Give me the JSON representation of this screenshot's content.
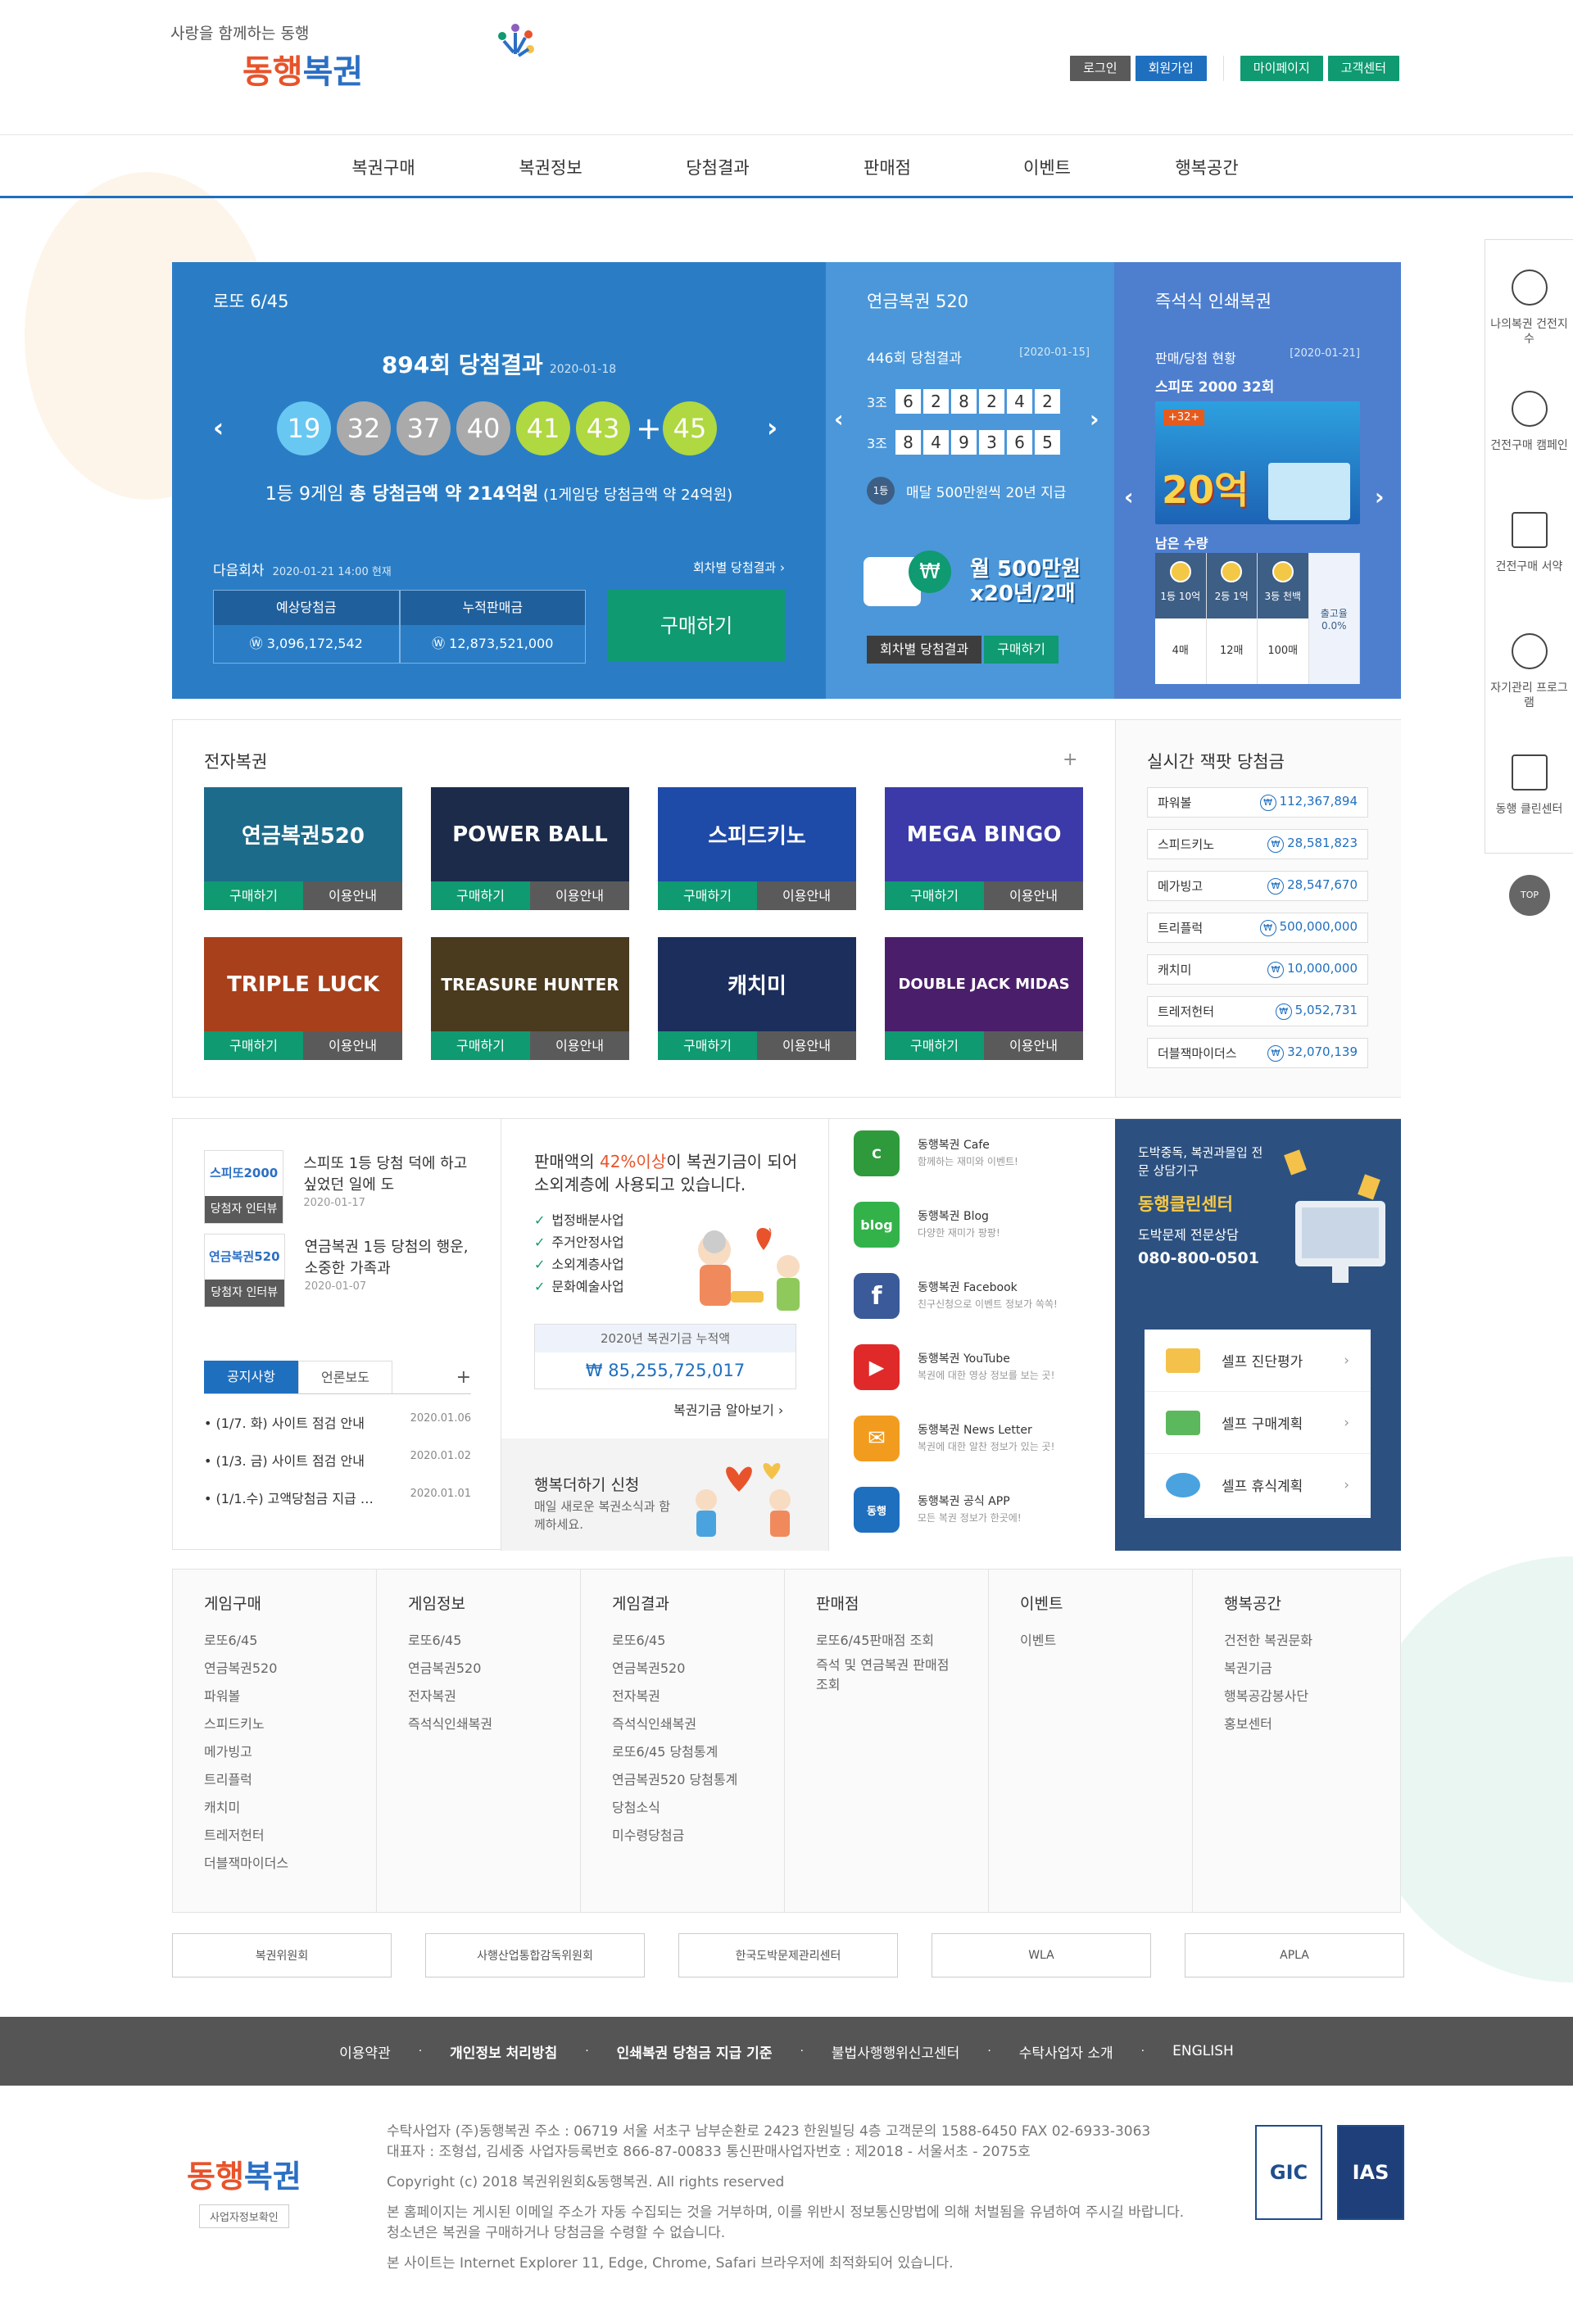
{
  "header": {
    "slogan": "사랑을 함께하는 동행",
    "logo_text_1": "동행",
    "logo_text_2": "복권",
    "top_buttons": [
      "로그인",
      "회원가입",
      "마이페이지",
      "고객센터"
    ]
  },
  "gnb": [
    "복권구매",
    "복권정보",
    "당첨결과",
    "판매점",
    "이벤트",
    "행복공간"
  ],
  "lotto": {
    "title": "로또 6/45",
    "round": "894회 당첨결과",
    "date": "2020-01-18",
    "balls": [
      "19",
      "32",
      "37",
      "40",
      "41",
      "43"
    ],
    "bonus": "45",
    "plus": "+",
    "desc_1": "1등 9게임 ",
    "desc_2": "총 당첨금액 약 214억원",
    "desc_3": " (1게임당 당첨금액 약 24억원)",
    "next_label": "다음회차",
    "next_date": "2020-01-21 14:00 현재",
    "by_round": "회차별 당첨결과 ›",
    "expected_label": "예상당첨금",
    "expected_value": "3,096,172,542",
    "sales_label": "누적판매금",
    "sales_value": "12,873,521,000",
    "buy": "구매하기"
  },
  "pension": {
    "title": "연금복권 520",
    "round": "446회 당첨결과",
    "date": "[2020-01-15]",
    "rows": [
      {
        "group": "3조",
        "digits": [
          "6",
          "2",
          "8",
          "2",
          "4",
          "2"
        ]
      },
      {
        "group": "3조",
        "digits": [
          "8",
          "4",
          "9",
          "3",
          "6",
          "5"
        ]
      }
    ],
    "badge": "1등",
    "info": "매달 500만원씩 20년 지급",
    "promo_1": "월 500만원",
    "promo_2": "x20년/2매",
    "coin": "₩",
    "btn_1": "회차별 당첨결과",
    "btn_2": "구매하기"
  },
  "instant": {
    "title": "즉석식 인쇄복권",
    "sub": "판매/당첨 현황",
    "date": "[2020-01-21]",
    "game": "스피또 2000 32회",
    "img_tag": "+32+",
    "img_big": "20억",
    "remain": "남은 수량",
    "ranks": [
      {
        "label": "1등 10억",
        "count": "4매"
      },
      {
        "label": "2등 1억",
        "count": "12매"
      },
      {
        "label": "3등 천백",
        "count": "100매"
      }
    ],
    "rate_label": "출고율",
    "rate": "0.0%"
  },
  "egame": {
    "title": "전자복권",
    "plus": "+",
    "buy": "구매하기",
    "info": "이용안내",
    "games": [
      {
        "name": "연금복권520",
        "color": "#1d6b8a"
      },
      {
        "name": "POWER BALL",
        "color": "#1c2b4a"
      },
      {
        "name": "스피드키노",
        "color": "#1e4aa8"
      },
      {
        "name": "MEGA BINGO",
        "color": "#3b3aa8"
      },
      {
        "name": "TRIPLE LUCK",
        "color": "#a8401c"
      },
      {
        "name": "TREASURE HUNTER",
        "color": "#4a3a1e"
      },
      {
        "name": "캐치미",
        "color": "#1b2e5c"
      },
      {
        "name": "DOUBLE JACK MIDAS",
        "color": "#4a1e6b"
      }
    ]
  },
  "jackpot": {
    "title": "실시간 잭팟 당첨금",
    "rows": [
      {
        "name": "파워볼",
        "value": "112,367,894"
      },
      {
        "name": "스피드키노",
        "value": "28,581,823"
      },
      {
        "name": "메가빙고",
        "value": "28,547,670"
      },
      {
        "name": "트리플럭",
        "value": "500,000,000"
      },
      {
        "name": "캐치미",
        "value": "10,000,000"
      },
      {
        "name": "트레저헌터",
        "value": "5,052,731"
      },
      {
        "name": "더블잭마이더스",
        "value": "32,070,139"
      }
    ]
  },
  "interviews": [
    {
      "logo": "스피또2000",
      "cap": "당첨자 인터뷰",
      "text": "스피또 1등 당첨 덕에 하고 싶었던 일에 도",
      "date": "2020-01-17"
    },
    {
      "logo": "연금복권520",
      "cap": "당첨자 인터뷰",
      "text": "연금복권 1등 당첨의 행운, 소중한 가족과",
      "date": "2020-01-07"
    }
  ],
  "notice": {
    "tab_on": "공지사항",
    "tab_off": "언론보도",
    "plus": "+",
    "rows": [
      {
        "title": "• (1/7. 화) 사이트 점검 안내",
        "date": "2020.01.06"
      },
      {
        "title": "• (1/3. 금) 사이트 점검 안내",
        "date": "2020.01.02"
      },
      {
        "title": "• (1/1.수) 고액당첨금 지급 …",
        "date": "2020.01.01"
      }
    ]
  },
  "fund": {
    "title_1": "판매액의 ",
    "title_hl": "42%이상",
    "title_2": "이 복권기금이 되어 소외계층에 사용되고 있습니다.",
    "items": [
      "법정배분사업",
      "주거안정사업",
      "소외계층사업",
      "문화예술사업"
    ],
    "acc_label": "2020년 복권기금 누적액",
    "acc_value": "₩ 85,255,725,017",
    "more": "복권기금 알아보기 ›",
    "happy_title": "행복더하기 신청",
    "happy_desc": "매일 새로운 복권소식과 함께하세요."
  },
  "sns": [
    {
      "title": "동행복권 Cafe",
      "desc": "함께하는 재미와 이벤트!",
      "color": "#2e9a3c",
      "icon": "C"
    },
    {
      "title": "동행복권 Blog",
      "desc": "다양한 재미가 팡팡!",
      "color": "#33b24a",
      "icon": "blog"
    },
    {
      "title": "동행복권 Facebook",
      "desc": "친구신청으로 이벤트 정보가 쏙쏙!",
      "color": "#3b5a9a",
      "icon": "f"
    },
    {
      "title": "동행복권 YouTube",
      "desc": "복권에 대한 영상 정보를 보는 곳!",
      "color": "#e02a2a",
      "icon": "▶"
    },
    {
      "title": "동행복권 News Letter",
      "desc": "복권에 대한 알찬 정보가 있는 곳!",
      "color": "#f29c1f",
      "icon": "✉"
    },
    {
      "title": "동행복권 공식 APP",
      "desc": "모든 복권 정보가 한곳에!",
      "color": "#1f6fbf",
      "icon": "동행"
    }
  ],
  "clean": {
    "sub": "도박중독, 복권과몰입 전문 상담기구",
    "title": "동행클린센터",
    "desc": "도박문제 전문상담",
    "phone": "080-800-0501",
    "items": [
      {
        "label": "셀프 진단평가",
        "color": "#f4c24a"
      },
      {
        "label": "셀프 구매계획",
        "color": "#5cb85c"
      },
      {
        "label": "셀프 휴식계획",
        "color": "#4aa3df"
      }
    ]
  },
  "sitemap": [
    {
      "title": "게임구매",
      "links": [
        "로또6/45",
        "연금복권520",
        "파워볼",
        "스피드키노",
        "메가빙고",
        "트리플럭",
        "캐치미",
        "트레저헌터",
        "더블잭마이더스"
      ]
    },
    {
      "title": "게임정보",
      "links": [
        "로또6/45",
        "연금복권520",
        "전자복권",
        "즉석식인쇄복권"
      ]
    },
    {
      "title": "게임결과",
      "links": [
        "로또6/45",
        "연금복권520",
        "전자복권",
        "즉석식인쇄복권",
        "로또6/45 당첨통계",
        "연금복권520 당첨통계",
        "당첨소식",
        "미수령당첨금"
      ]
    },
    {
      "title": "판매점",
      "links": [
        "로또6/45판매점 조회",
        "즉석 및 연금복권 판매점",
        "조회"
      ]
    },
    {
      "title": "이벤트",
      "links": [
        "이벤트"
      ]
    },
    {
      "title": "행복공간",
      "links": [
        "건전한 복권문화",
        "복권기금",
        "행복공감봉사단",
        "홍보센터"
      ]
    }
  ],
  "partners": [
    "복권위원회",
    "사행산업통합감독위원회",
    "한국도박문제관리센터",
    "WLA",
    "APLA"
  ],
  "footer_links": [
    "이용약관",
    "개인정보 처리방침",
    "인쇄복권 당첨금 지급 기준",
    "불법사행행위신고센터",
    "수탁사업자 소개",
    "ENGLISH"
  ],
  "footer": {
    "logo_1": "동행",
    "logo_2": "복권",
    "tag": "사업자정보확인",
    "line1": "수탁사업자 (주)동행복권    주소 : 06719 서울 서초구 남부순환로 2423 한원빌딩 4층    고객문의 1588-6450    FAX 02-6933-3063",
    "line2": "대표자 : 조형섭, 김세중    사업자등록번호 866-87-00833    통신판매사업자번호 : 제2018 - 서울서초 - 2075호",
    "copyright": "Copyright (c) 2018 복권위원회&동행복권. All rights reserved",
    "notice1": "본 홈페이지는 게시된 이메일 주소가 자동 수집되는 것을 거부하며, 이를 위반시 정보통신망법에 의해 처벌됨을 유념하여 주시길 바랍니다.",
    "notice2": "청소년은 복권을 구매하거나 당첨금을 수령할 수 없습니다.",
    "browser": "본 사이트는 Internet Explorer 11, Edge, Chrome, Safari 브라우저에 최적화되어 있습니다.",
    "cert_1": "GIC",
    "cert_2": "IAS"
  },
  "quick": [
    "나의복권 건전지수",
    "건전구매 캠페인",
    "건전구매 서약",
    "자기관리 프로그램",
    "동행 클린센터"
  ],
  "top_label": "TOP"
}
